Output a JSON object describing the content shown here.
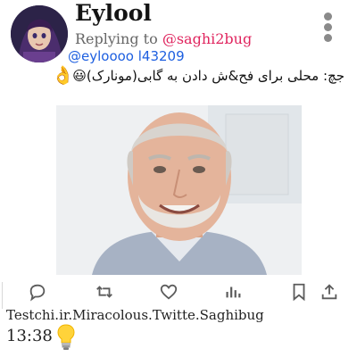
{
  "author": {
    "display_name": "Eylool",
    "reply_prefix": "Replying to",
    "reply_to": "@saghi2bug",
    "reply_to_2": "@eyloooo l43209"
  },
  "tweet": {
    "text": "جچ: محلی برای فح&ش دادن به گابی(مونارک)😃",
    "trailing_emoji": "👌"
  },
  "actions": [
    "reply-icon",
    "retweet-icon",
    "like-icon",
    "analytics-icon",
    "bookmark-icon",
    "share-icon"
  ],
  "footer": {
    "source": "Testchi.ir.Miracolous.Twitte.Saghibug",
    "time": "13:38"
  },
  "colors": {
    "mention": "#e0245e",
    "handle": "#1d5fe0",
    "icon": "#5c5c5c"
  }
}
